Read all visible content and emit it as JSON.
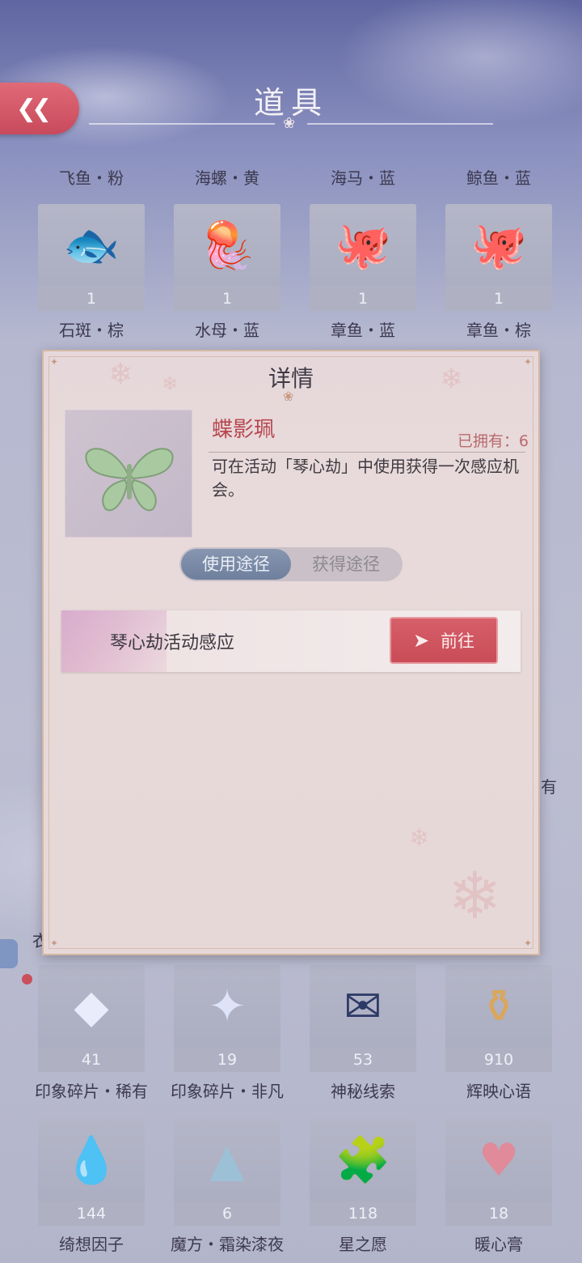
{
  "header": {
    "title": "道具",
    "back_icon": "double-chevron-left-icon"
  },
  "row_top_labels": [
    "飞鱼・粉",
    "海螺・黄",
    "海马・蓝",
    "鲸鱼・蓝"
  ],
  "row2": {
    "items": [
      {
        "name": "石斑・棕",
        "count": "1",
        "icon": "fish-icon"
      },
      {
        "name": "水母・蓝",
        "count": "1",
        "icon": "jellyfish-icon"
      },
      {
        "name": "章鱼・蓝",
        "count": "1",
        "icon": "octopus-icon"
      },
      {
        "name": "章鱼・棕",
        "count": "1",
        "icon": "octopus-icon"
      }
    ]
  },
  "side_labels": {
    "right_partial": "有",
    "left_partial": "衣"
  },
  "detail": {
    "title": "详情",
    "item_name": "蝶影珮",
    "owned_label": "已拥有：6",
    "description": "可在活动「琴心劫」中使用获得一次感应机会。",
    "tab_use": "使用途径",
    "tab_obtain": "获得途径",
    "route_label": "琴心劫活动感应",
    "go_label": "前往",
    "item_icon": "butterfly-pendant-icon"
  },
  "row5": {
    "items": [
      {
        "name": "印象碎片・稀有",
        "count": "41",
        "icon": "crystal-shard-icon"
      },
      {
        "name": "印象碎片・非凡",
        "count": "19",
        "icon": "crystal-diamond-icon"
      },
      {
        "name": "神秘线索",
        "count": "53",
        "icon": "envelope-icon"
      },
      {
        "name": "辉映心语",
        "count": "910",
        "icon": "perfume-bottle-icon"
      }
    ]
  },
  "row6": {
    "items": [
      {
        "name": "绮想因子",
        "count": "144",
        "icon": "water-drop-icon"
      },
      {
        "name": "魔方・霜染漆夜",
        "count": "6",
        "icon": "pyramid-icon"
      },
      {
        "name": "星之愿",
        "count": "118",
        "icon": "puzzle-piece-icon"
      },
      {
        "name": "暖心膏",
        "count": "18",
        "icon": "heart-box-icon"
      }
    ]
  },
  "colors": {
    "accent_red": "#c94c57",
    "item_name_red": "#b7474f",
    "toggle_active": "#6e7f9d"
  }
}
